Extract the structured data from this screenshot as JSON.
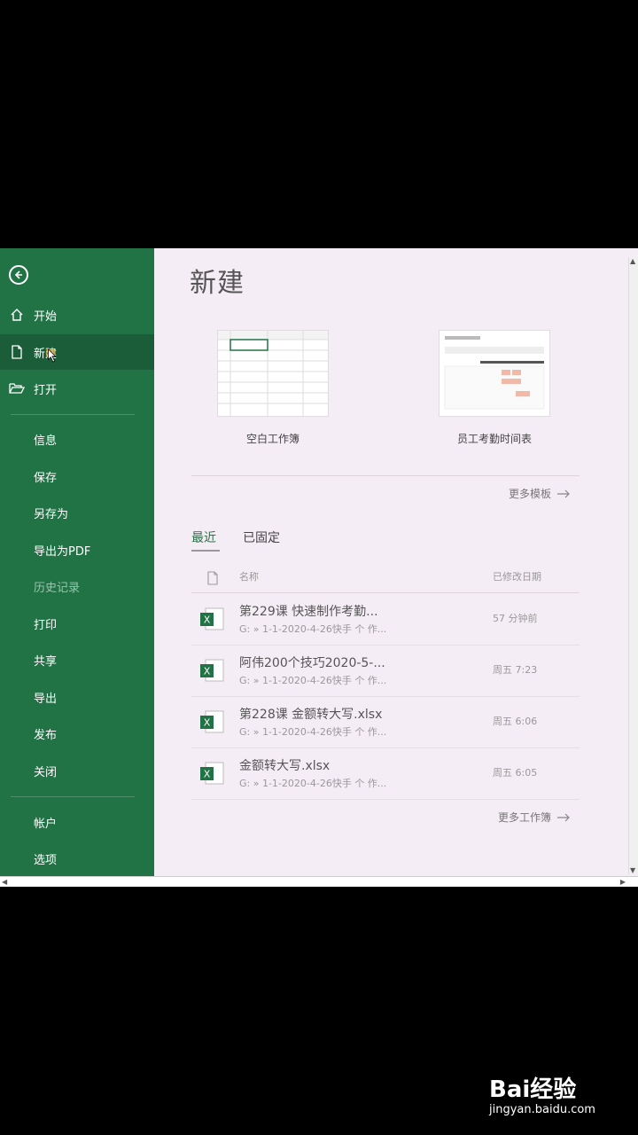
{
  "sidebar": {
    "items": [
      {
        "label": "开始"
      },
      {
        "label": "新建"
      },
      {
        "label": "打开"
      },
      {
        "label": "信息"
      },
      {
        "label": "保存"
      },
      {
        "label": "另存为"
      },
      {
        "label": "导出为PDF"
      },
      {
        "label": "历史记录"
      },
      {
        "label": "打印"
      },
      {
        "label": "共享"
      },
      {
        "label": "导出"
      },
      {
        "label": "发布"
      },
      {
        "label": "关闭"
      },
      {
        "label": "帐户"
      },
      {
        "label": "选项"
      }
    ],
    "selected": "新建"
  },
  "main": {
    "title": "新建",
    "templates": [
      {
        "label": "空白工作簿",
        "icon": "blank-workbook-thumbnail"
      },
      {
        "label": "员工考勤时间表",
        "icon": "attendance-template-thumbnail"
      }
    ],
    "more_templates": "更多模板",
    "tabs": [
      {
        "label": "最近"
      },
      {
        "label": "已固定"
      }
    ],
    "columns": {
      "name": "名称",
      "modified": "已修改日期"
    },
    "files": [
      {
        "name": "第229课 快速制作考勤...",
        "path": "G: » 1-1-2020-4-26快手 个 作...",
        "date": "57 分钟前"
      },
      {
        "name": "阿伟200个技巧2020-5-...",
        "path": "G: » 1-1-2020-4-26快手 个 作...",
        "date": "周五 7:23"
      },
      {
        "name": "第228课 金额转大写.xlsx",
        "path": "G: » 1-1-2020-4-26快手 个 作...",
        "date": "周五 6:06"
      },
      {
        "name": "金额转大写.xlsx",
        "path": "G: » 1-1-2020-4-26快手 个 作...",
        "date": "周五 6:05"
      }
    ],
    "more_workbooks": "更多工作簿"
  },
  "watermark": {
    "brand": "Bai经验",
    "url": "jingyan.baidu.com"
  },
  "colors": {
    "sidebar": "#217346",
    "selected": "#1b5d39",
    "background": "#f5edf5"
  }
}
